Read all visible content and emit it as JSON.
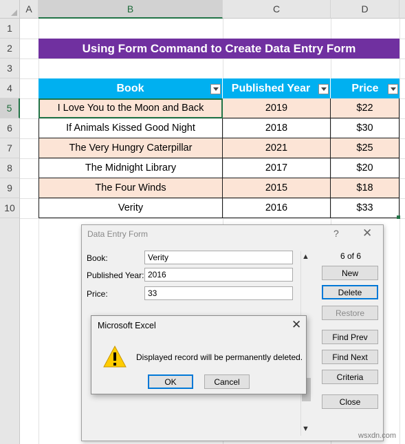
{
  "sheet": {
    "columns": [
      "A",
      "B",
      "C",
      "D"
    ],
    "rows": [
      "1",
      "2",
      "3",
      "4",
      "5",
      "6",
      "7",
      "8",
      "9",
      "10"
    ],
    "selected_column": "B",
    "selected_row": "5"
  },
  "banner": {
    "title": "Using Form Command to Create Data Entry Form"
  },
  "table": {
    "headers": [
      "Book",
      "Published Year",
      "Price"
    ],
    "rows": [
      [
        "I Love You to the Moon and Back",
        "2019",
        "$22"
      ],
      [
        "If Animals Kissed Good Night",
        "2018",
        "$30"
      ],
      [
        "The Very Hungry Caterpillar",
        "2021",
        "$25"
      ],
      [
        "The Midnight Library",
        "2017",
        "$20"
      ],
      [
        "The Four Winds",
        "2015",
        "$18"
      ],
      [
        "Verity",
        "2016",
        "$33"
      ]
    ],
    "header_color": "#00b0f0",
    "alt_row_color": "#fce4d6"
  },
  "form": {
    "title": "Data Entry Form",
    "help": "?",
    "close": "✕",
    "fields": [
      {
        "label": "Book:",
        "value": "Verity"
      },
      {
        "label": "Published Year:",
        "value": "2016"
      },
      {
        "label": "Price:",
        "value": "33"
      }
    ],
    "counter": "6 of 6",
    "buttons": [
      "New",
      "Delete",
      "Restore",
      "Find Prev",
      "Find Next",
      "Criteria",
      "Close"
    ],
    "scroll_up": "▲",
    "scroll_down": "▼"
  },
  "message_box": {
    "title": "Microsoft Excel",
    "close": "✕",
    "text": "Displayed record will be permanently deleted.",
    "ok": "OK",
    "cancel": "Cancel",
    "icon": "warning-icon"
  },
  "watermark": "wsxdn.com",
  "colors": {
    "banner": "#7030a0",
    "selection": "#217346",
    "focus": "#0078d7"
  }
}
